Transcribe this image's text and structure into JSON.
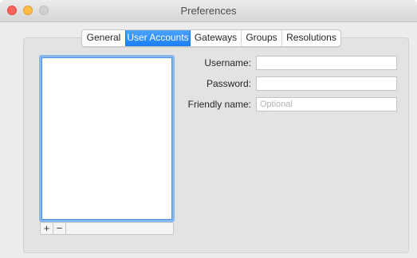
{
  "window": {
    "title": "Preferences"
  },
  "tabs": [
    {
      "label": "General",
      "selected": false
    },
    {
      "label": "User Accounts",
      "selected": true
    },
    {
      "label": "Gateways",
      "selected": false
    },
    {
      "label": "Groups",
      "selected": false
    },
    {
      "label": "Resolutions",
      "selected": false
    }
  ],
  "accounts_list": {
    "items": [],
    "add_label": "+",
    "remove_label": "−"
  },
  "form": {
    "username_label": "Username:",
    "username_value": "",
    "password_label": "Password:",
    "password_value": "",
    "friendly_name_label": "Friendly name:",
    "friendly_name_value": "",
    "friendly_name_placeholder": "Optional"
  },
  "colors": {
    "accent": "#1a7ef5",
    "close": "#fc605c",
    "minimize": "#fdbc40",
    "zoom_disabled": "#d1d1d1"
  }
}
